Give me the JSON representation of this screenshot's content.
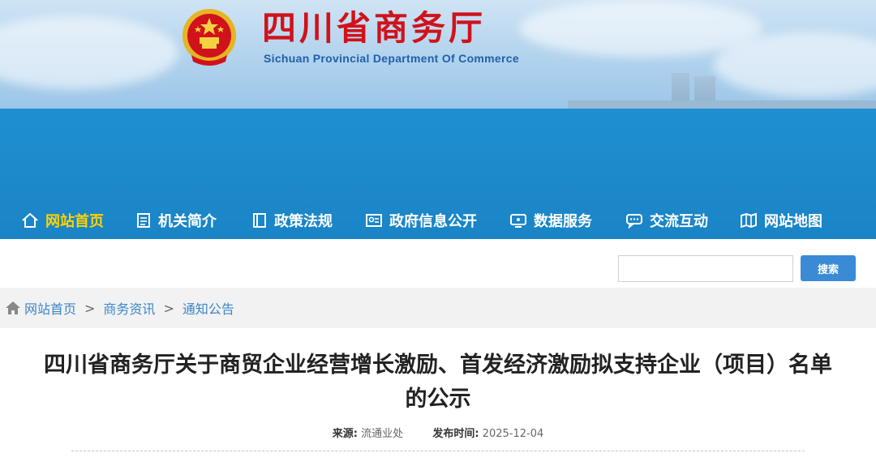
{
  "header": {
    "title": "四川省商务厅",
    "subtitle": "Sichuan Provincial Department Of Commerce",
    "emblem_icon": "national-emblem-icon"
  },
  "nav": {
    "items": [
      {
        "label": "网站首页",
        "icon": "home-icon",
        "active": true
      },
      {
        "label": "机关简介",
        "icon": "document-icon",
        "active": false
      },
      {
        "label": "政策法规",
        "icon": "book-icon",
        "active": false
      },
      {
        "label": "政府信息公开",
        "icon": "id-card-icon",
        "active": false
      },
      {
        "label": "数据服务",
        "icon": "monitor-icon",
        "active": false
      },
      {
        "label": "交流互动",
        "icon": "chat-icon",
        "active": false
      },
      {
        "label": "网站地图",
        "icon": "map-icon",
        "active": false
      }
    ]
  },
  "search": {
    "value": "",
    "placeholder": "",
    "button_label": "搜索"
  },
  "breadcrumb": {
    "icon": "home-icon",
    "items": [
      "网站首页",
      "商务资讯",
      "通知公告"
    ],
    "separator": ">"
  },
  "article": {
    "title_line1": "四川省商务厅关于商贸企业经营增长激励、首发经济激励拟支持企业（项目）名单",
    "title_line2": "的公示",
    "source_label": "来源:",
    "source_value": "流通业处",
    "date_label": "发布时间:",
    "date_value": "2025-12-04"
  },
  "colors": {
    "brand_red": "#d0121b",
    "nav_blue": "#1a84c6",
    "nav_active": "#ffd200",
    "link_blue": "#3a86c8"
  }
}
